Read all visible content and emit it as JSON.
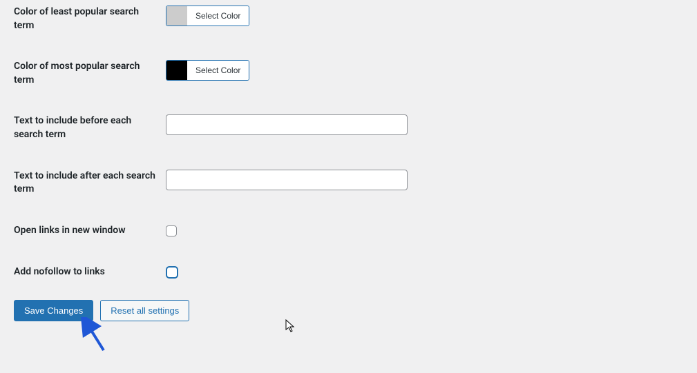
{
  "fields": {
    "color_least": {
      "label": "Color of least popular search term",
      "button": "Select Color",
      "swatch_hex": "#cccccc"
    },
    "color_most": {
      "label": "Color of most popular search term",
      "button": "Select Color",
      "swatch_hex": "#000000"
    },
    "text_before": {
      "label": "Text to include before each search term",
      "value": ""
    },
    "text_after": {
      "label": "Text to include after each search term",
      "value": ""
    },
    "open_new_window": {
      "label": "Open links in new window",
      "checked": false
    },
    "add_nofollow": {
      "label": "Add nofollow to links",
      "checked": false
    }
  },
  "buttons": {
    "save": "Save Changes",
    "reset": "Reset all settings"
  }
}
